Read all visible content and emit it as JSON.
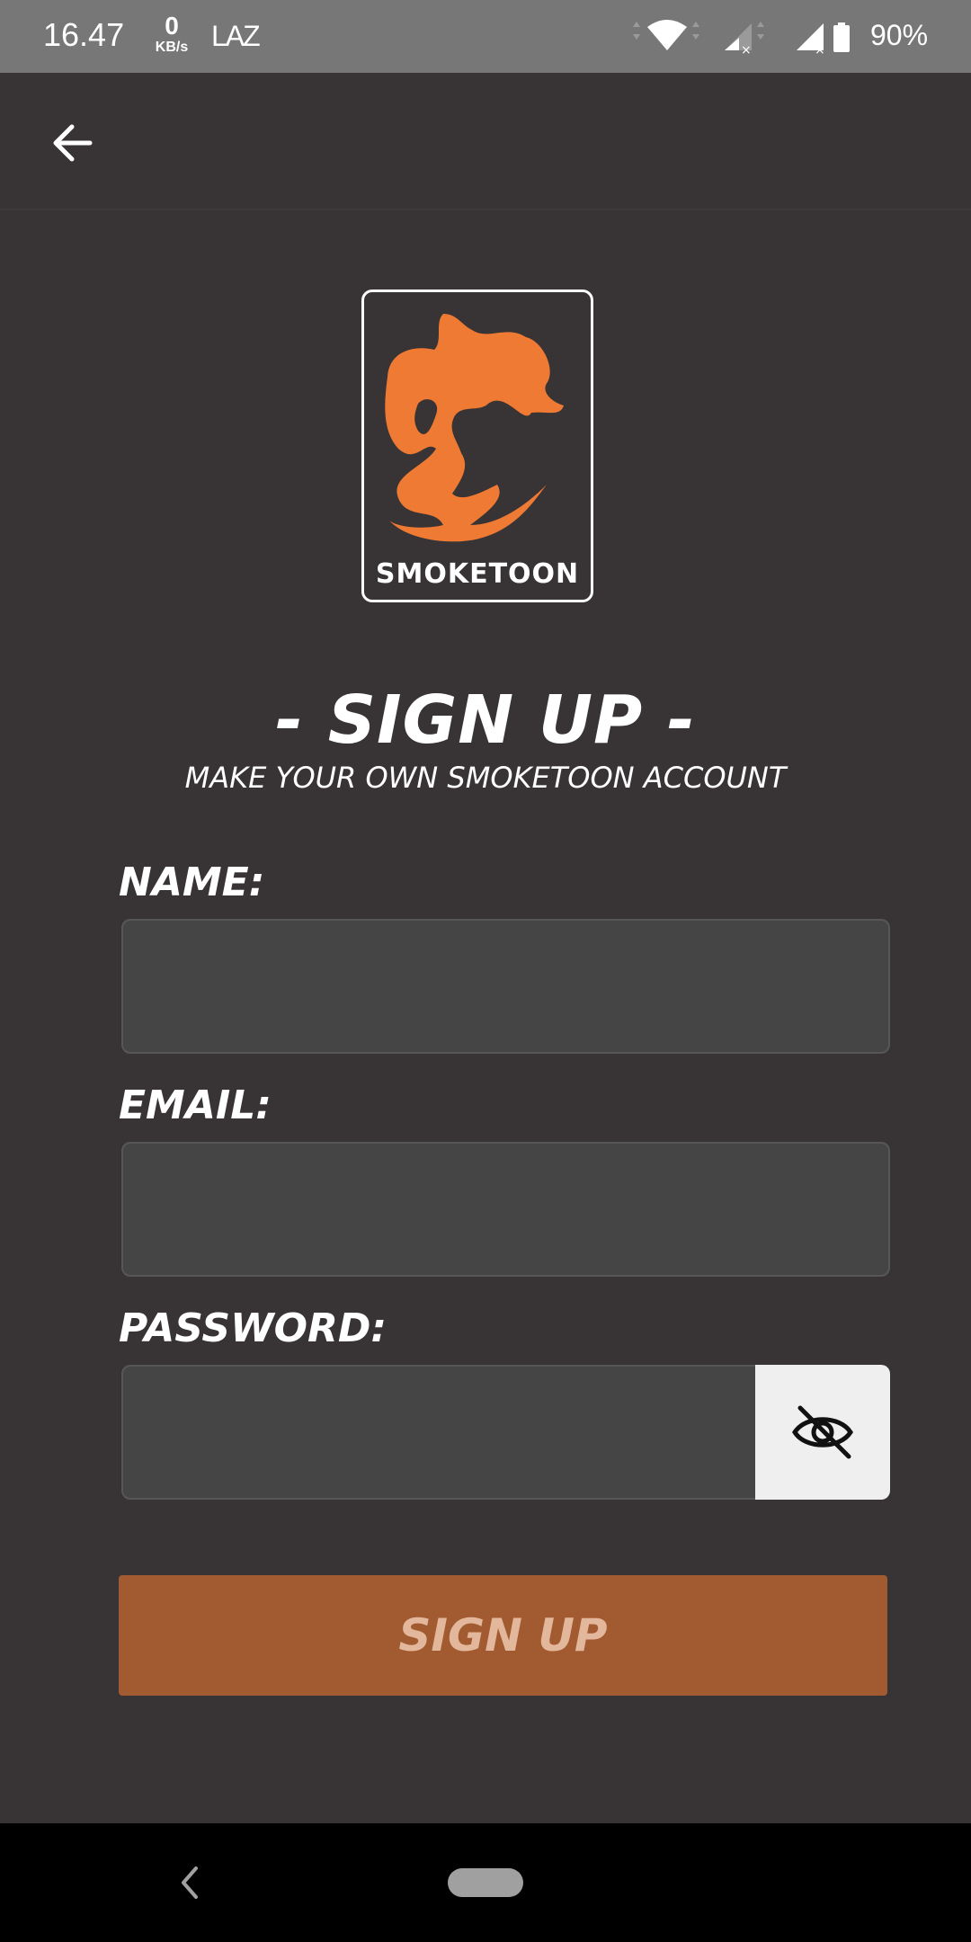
{
  "status_bar": {
    "time": "16.47",
    "net_speed_value": "0",
    "net_speed_unit": "KB/s",
    "carrier": "LAZ",
    "battery_percent": "90%",
    "icons": [
      "wifi-icon",
      "signal-icon",
      "signal-icon",
      "battery-icon"
    ]
  },
  "app_bar": {
    "back_icon": "arrow-left-icon"
  },
  "logo": {
    "brand_text": "SMOKETOON",
    "accent_color": "#ef7a33"
  },
  "header": {
    "title": "- SIGN UP -",
    "subtitle": "MAKE YOUR OWN SMOKETOON ACCOUNT"
  },
  "form": {
    "name_label": "NAME:",
    "name_value": "",
    "email_label": "EMAIL:",
    "email_value": "",
    "password_label": "PASSWORD:",
    "password_value": "",
    "password_toggle_icon": "eye-off-icon",
    "submit_label": "SIGN UP"
  },
  "colors": {
    "background": "#383334",
    "input_background": "#454545",
    "button": "#a25b31",
    "button_text": "#e3b79c",
    "status_bar": "#777777"
  },
  "nav_bar": {
    "back_icon": "chevron-left-icon",
    "home_icon": "home-pill-icon"
  }
}
